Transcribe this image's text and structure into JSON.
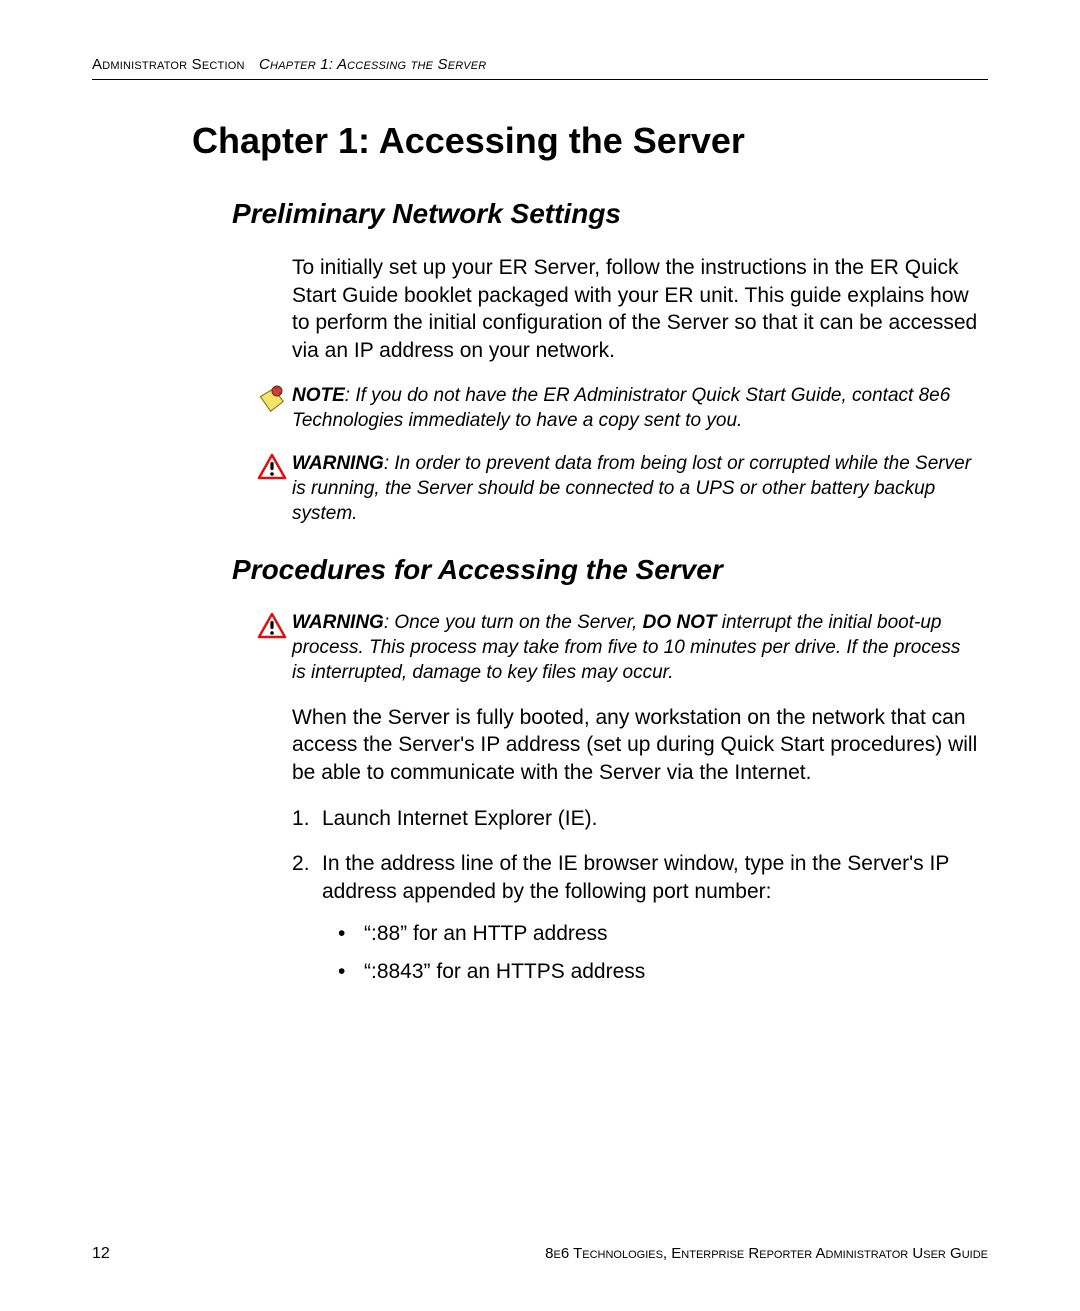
{
  "header": {
    "section": "Administrator Section",
    "chapter": "Chapter 1: Accessing the Server"
  },
  "chapter_title": "Chapter 1: Accessing the Server",
  "section1": {
    "title": "Preliminary Network Settings",
    "intro": "To initially set up your ER Server, follow the instructions in the ER Quick Start Guide booklet packaged with your ER unit. This guide explains how to perform the initial configuration of the Server so that it can be accessed via an IP address on your network.",
    "note_label": "NOTE",
    "note_text": ": If you do not have the ER Administrator Quick Start Guide, contact 8e6 Technologies immediately to have a copy sent to you.",
    "warn_label": "WARNING",
    "warn_text": ": In order to prevent data from being lost or corrupted while the Server is running, the Server should be connected to a UPS or other battery backup system."
  },
  "section2": {
    "title": "Procedures for Accessing the Server",
    "warn_label": "WARNING",
    "warn_pre": ": Once you turn on the Server, ",
    "warn_bold": "DO NOT",
    "warn_post": " interrupt the initial boot-up process. This process may take from five to 10 minutes per drive. If the process is interrupted, damage to key files may occur.",
    "intro": "When the Server is fully booted, any workstation on the network that can access the Server's IP address (set up during Quick Start procedures) will be able to communicate with the Server via the Internet.",
    "step1": "Launch Internet Explorer (IE).",
    "step2": "In the address line of the IE browser window, type in the Server's IP address appended by the following port number:",
    "bullet1": "“:88” for an HTTP address",
    "bullet2": "“:8843” for an HTTPS address"
  },
  "footer": {
    "page": "12",
    "guide": "8e6 Technologies, Enterprise Reporter Administrator User Guide"
  }
}
